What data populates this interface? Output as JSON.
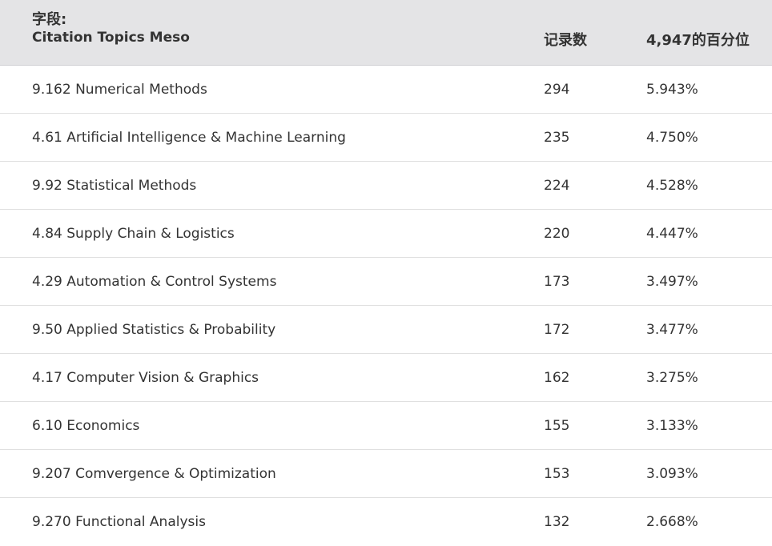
{
  "header": {
    "field_label": "字段:",
    "field_name": "Citation Topics Meso",
    "count_label": "记录数",
    "percent_label": "4,947的百分位"
  },
  "rows": [
    {
      "topic": "9.162 Numerical Methods",
      "count": "294",
      "percent": "5.943%"
    },
    {
      "topic": "4.61 Artificial Intelligence & Machine Learning",
      "count": "235",
      "percent": "4.750%"
    },
    {
      "topic": "9.92 Statistical Methods",
      "count": "224",
      "percent": "4.528%"
    },
    {
      "topic": "4.84 Supply Chain & Logistics",
      "count": "220",
      "percent": "4.447%"
    },
    {
      "topic": "4.29 Automation & Control Systems",
      "count": "173",
      "percent": "3.497%"
    },
    {
      "topic": "9.50 Applied Statistics & Probability",
      "count": "172",
      "percent": "3.477%"
    },
    {
      "topic": "4.17 Computer Vision & Graphics",
      "count": "162",
      "percent": "3.275%"
    },
    {
      "topic": "6.10 Economics",
      "count": "155",
      "percent": "3.133%"
    },
    {
      "topic": "9.207 Comvergence & Optimization",
      "count": "153",
      "percent": "3.093%"
    },
    {
      "topic": "9.270 Functional Analysis",
      "count": "132",
      "percent": "2.668%"
    }
  ]
}
